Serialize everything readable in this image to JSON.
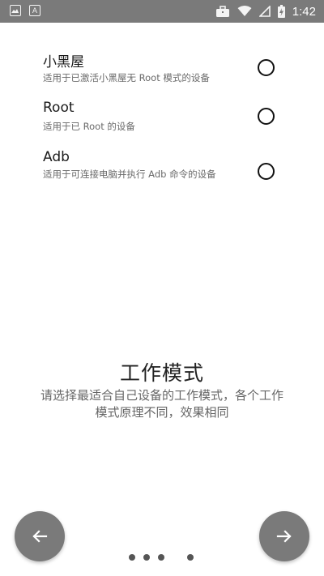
{
  "status_bar": {
    "time": "1:42",
    "left_icons": [
      "image-notification-icon",
      "text-a-notification-icon"
    ],
    "right_icons": [
      "briefcase-icon",
      "wifi-icon",
      "signal-icon",
      "battery-charging-icon"
    ]
  },
  "modes": [
    {
      "title": "小黑屋",
      "description": "适用于已激活小黑屋无 Root 模式的设备",
      "selected": false
    },
    {
      "title": "Root",
      "description": "适用于已 Root 的设备",
      "selected": false
    },
    {
      "title": "Adb",
      "description": "适用于可连接电脑并执行 Adb 命令的设备",
      "selected": false
    }
  ],
  "hero": {
    "title": "工作模式",
    "subtitle": "请选择最适合自己设备的工作模式，各个工作模式原理不同，效果相同"
  },
  "navigation": {
    "back_icon": "arrow-left-icon",
    "next_icon": "arrow-right-icon",
    "page_count": 4,
    "current_page": 4
  },
  "colors": {
    "status_bar": "#7a7a7a",
    "nav_button": "#7a7a7a",
    "dot": "#555555"
  }
}
